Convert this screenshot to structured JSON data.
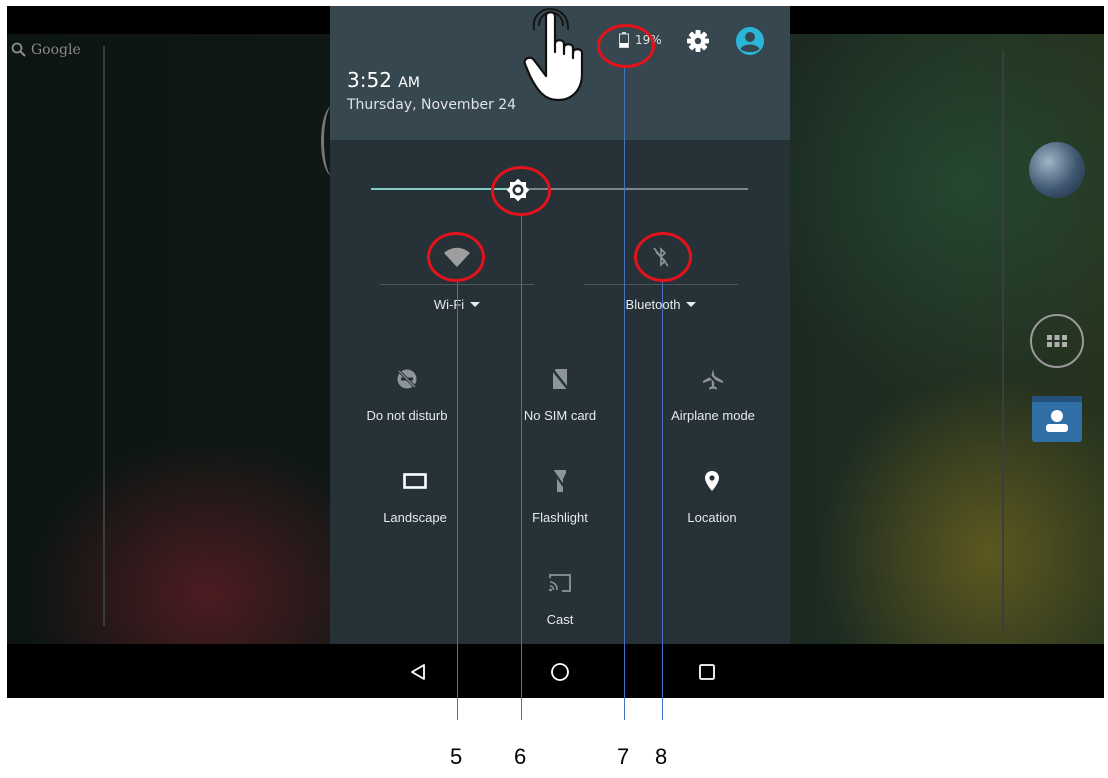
{
  "home": {
    "search_label": "Google"
  },
  "status": {
    "time": "3:52",
    "time_suffix": "AM",
    "date": "Thursday, November 24",
    "battery": "19%"
  },
  "brightness": {
    "level": 0.39
  },
  "big_tiles": [
    {
      "label": "Wi-Fi",
      "icon": "wifi-icon"
    },
    {
      "label": "Bluetooth",
      "icon": "bluetooth-off-icon"
    }
  ],
  "tiles": [
    {
      "label": "Do not disturb",
      "icon": "do-not-disturb-icon"
    },
    {
      "label": "No SIM card",
      "icon": "no-sim-icon"
    },
    {
      "label": "Airplane mode",
      "icon": "airplane-icon"
    },
    {
      "label": "Landscape",
      "icon": "landscape-icon"
    },
    {
      "label": "Flashlight",
      "icon": "flashlight-icon"
    },
    {
      "label": "Location",
      "icon": "location-icon"
    },
    {
      "label": "Cast",
      "icon": "cast-icon"
    }
  ],
  "callouts": [
    "5",
    "6",
    "7",
    "8"
  ],
  "colors": {
    "accent": "#80cbc4",
    "shade_background": "#263238",
    "header_background": "#37474f",
    "callout_ring": "#e3121b",
    "leader_line": "#4472c4",
    "avatar": "#29b6d8"
  }
}
